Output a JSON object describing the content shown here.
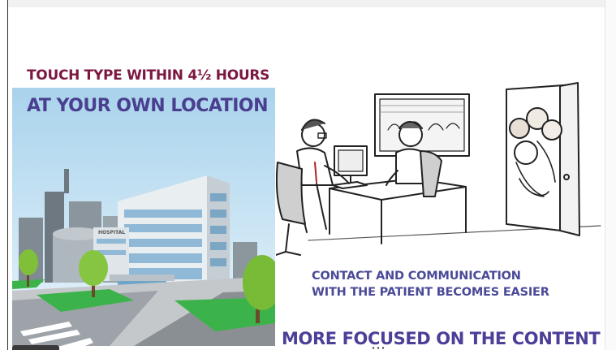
{
  "slide": {
    "heading_touch": "TOUCH TYPE WITHIN 4½ HOURS",
    "heading_location": "AT YOUR OWN LOCATION",
    "building_sign": "HOSPITAL",
    "caption_line1": "CONTACT AND COMMUNICATION",
    "caption_line2": "WITH THE PATIENT BECOMES EASIER",
    "heading_focused": "MORE FOCUSED ON THE CONTENT"
  },
  "colors": {
    "heading_touch": "#7b1740",
    "heading_location": "#4a3f8f",
    "caption": "#4a4a98",
    "sky": "#c9e3f2",
    "grass": "#3bb34a",
    "road": "#8a8f93"
  },
  "icons": {
    "city": "hospital-city-illustration",
    "doctor": "doctor-patient-illustration",
    "crowd": "crowd-at-door-illustration"
  }
}
